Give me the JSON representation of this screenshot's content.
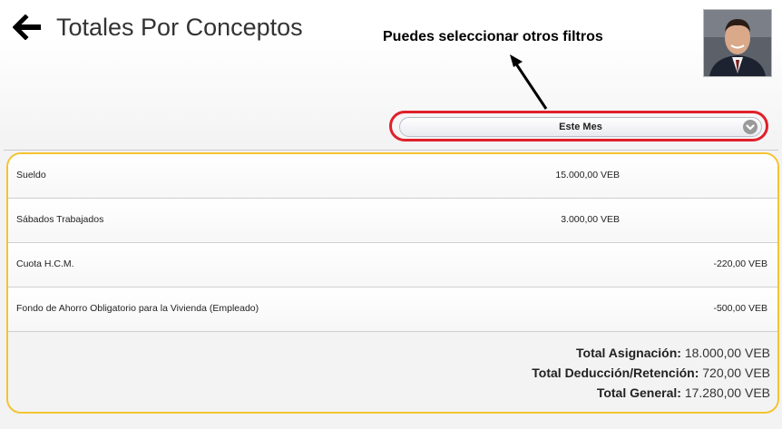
{
  "header": {
    "title": "Totales Por Conceptos",
    "back_icon": "arrow-left-icon",
    "avatar_alt": "user-avatar-photo"
  },
  "hint": {
    "text": "Puedes seleccionar otros filtros"
  },
  "filter": {
    "selected": "Este Mes",
    "icon": "chevron-down-circle-icon",
    "highlight_color": "#e0202a"
  },
  "panel": {
    "border_color": "#f4c430",
    "rows": [
      {
        "concept": "Sueldo",
        "asignacion": "15.000,00 VEB",
        "deduccion": ""
      },
      {
        "concept": "Sábados Trabajados",
        "asignacion": "3.000,00 VEB",
        "deduccion": ""
      },
      {
        "concept": "Cuota H.C.M.",
        "asignacion": "",
        "deduccion": "-220,00 VEB"
      },
      {
        "concept": "Fondo de Ahorro Obligatorio para la Vivienda (Empleado)",
        "asignacion": "",
        "deduccion": "-500,00 VEB"
      }
    ],
    "totals": {
      "asignacion_label": "Total Asignación:",
      "asignacion_value": "18.000,00 VEB",
      "deduccion_label": "Total Deducción/Retención:",
      "deduccion_value": "720,00 VEB",
      "general_label": "Total General:",
      "general_value": "17.280,00 VEB"
    }
  }
}
